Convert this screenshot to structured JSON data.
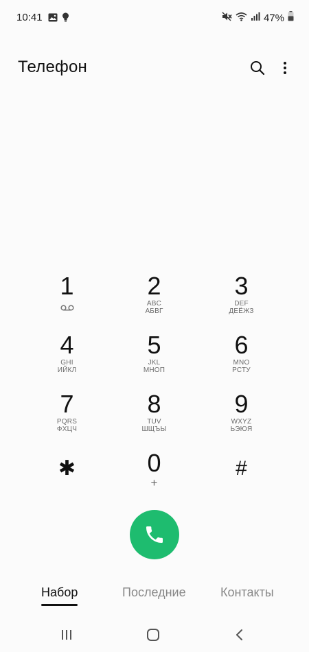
{
  "status_bar": {
    "time": "10:41",
    "battery": "47%",
    "left_icons": [
      "image-icon",
      "bulb-icon"
    ],
    "right_icons": [
      "mute-icon",
      "wifi-icon",
      "signal-icon",
      "battery-icon"
    ]
  },
  "header": {
    "title": "Телефон",
    "icons": [
      "search-icon",
      "more-vertical-icon"
    ]
  },
  "keypad": {
    "keys": [
      {
        "digit": "1",
        "icon": "voicemail-icon"
      },
      {
        "digit": "2",
        "latin": "ABC",
        "cyrillic": "АБВГ"
      },
      {
        "digit": "3",
        "latin": "DEF",
        "cyrillic": "ДЕЁЖЗ"
      },
      {
        "digit": "4",
        "latin": "GHI",
        "cyrillic": "ИЙКЛ"
      },
      {
        "digit": "5",
        "latin": "JKL",
        "cyrillic": "МНОП"
      },
      {
        "digit": "6",
        "latin": "MNO",
        "cyrillic": "РСТУ"
      },
      {
        "digit": "7",
        "latin": "PQRS",
        "cyrillic": "ФХЦЧ"
      },
      {
        "digit": "8",
        "latin": "TUV",
        "cyrillic": "ШЩЪЫ"
      },
      {
        "digit": "9",
        "latin": "WXYZ",
        "cyrillic": "ЬЭЮЯ"
      },
      {
        "digit": "✱"
      },
      {
        "digit": "0",
        "extra": "+"
      },
      {
        "digit": "#"
      }
    ]
  },
  "call_button": {
    "icon": "phone-icon",
    "color": "#1ebc6f"
  },
  "tabs": [
    {
      "label": "Набор",
      "active": true
    },
    {
      "label": "Последние",
      "active": false
    },
    {
      "label": "Контакты",
      "active": false
    }
  ],
  "nav_bar": {
    "icons": [
      "recents-icon",
      "home-icon",
      "back-icon"
    ]
  }
}
